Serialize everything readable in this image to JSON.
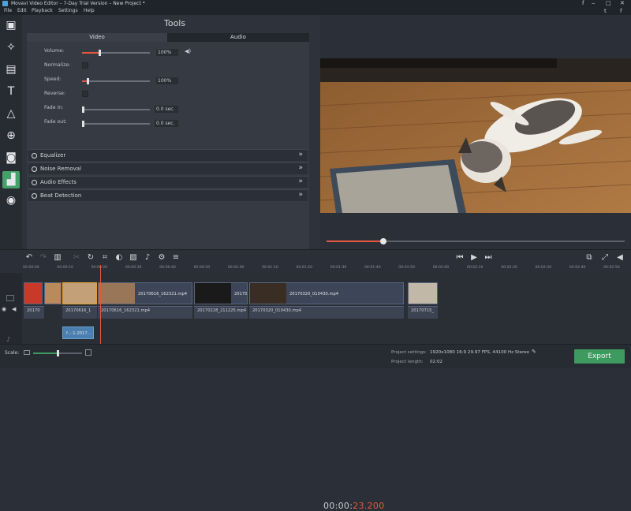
{
  "window": {
    "title": "Movavi Video Editor – 7-Day Trial Version – New Project *",
    "min": "‒",
    "max": "□",
    "close": "✕"
  },
  "social": {
    "a": "f",
    "b": "t"
  },
  "menu": [
    "File",
    "Edit",
    "Playback",
    "Settings",
    "Help"
  ],
  "tools": {
    "title": "Tools",
    "tabs": {
      "video": "Video",
      "audio": "Audio"
    },
    "audio": {
      "volume": {
        "label": "Volume:",
        "value": "100%",
        "level": 0.25
      },
      "normalize": {
        "label": "Normalize:"
      },
      "speed": {
        "label": "Speed:",
        "value": "100%",
        "level": 0.08
      },
      "reverse": {
        "label": "Reverse:"
      },
      "fade_in": {
        "label": "Fade in:",
        "value": "0.0 sec."
      },
      "fade_out": {
        "label": "Fade out:",
        "value": "0.0 sec."
      }
    },
    "sections": [
      "Equalizer",
      "Noise Removal",
      "Audio Effects",
      "Beat Detection"
    ]
  },
  "player": {
    "timecode_main": "00:00:",
    "timecode_frac": "23.200",
    "progress": 0.19
  },
  "ruler": [
    "00:00:00",
    "00:00:10",
    "00:00:20",
    "00:00:30",
    "00:00:40",
    "00:00:50",
    "00:01:00",
    "00:01:10",
    "00:01:20",
    "00:01:30",
    "00:01:40",
    "00:01:50",
    "00:02:00",
    "00:02:10",
    "00:02:20",
    "00:02:30",
    "00:02:40",
    "00:02:50"
  ],
  "clips": {
    "video": [
      "20170616_162321.mp4",
      "20170",
      "20170320_010430.mp4"
    ],
    "audio": [
      "20170",
      "20170616_1",
      "20170616_162321.mp4",
      "20170228_211225.mp4",
      "20170320_010430.mp4",
      "20170715_"
    ],
    "overlay": "f...-1-2017..."
  },
  "status": {
    "scale_label": "Scale:",
    "settings_label": "Project settings:",
    "settings_value": "1920x1080 16:9 29.97 FPS, 44100 Hz Stereo",
    "length_label": "Project length:",
    "length_value": "02:02"
  },
  "export_label": "Export"
}
